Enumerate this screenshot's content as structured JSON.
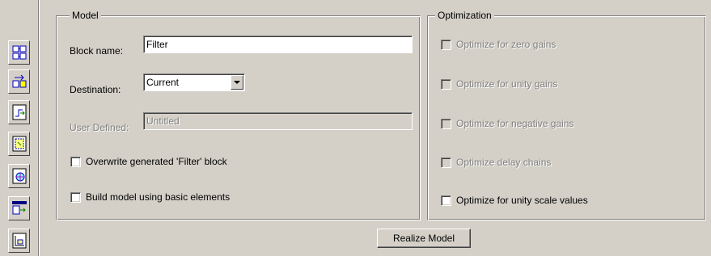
{
  "toolbar": {
    "icons": [
      "structure-icon",
      "convert-icon",
      "filter-response-icon",
      "selection-icon",
      "target-icon",
      "realize-icon",
      "transform-icon"
    ]
  },
  "model": {
    "title": "Model",
    "block_name_label": "Block name:",
    "block_name_value": "Filter",
    "destination_label": "Destination:",
    "destination_value": "Current",
    "user_defined_label": "User Defined:",
    "user_defined_value": "Untitled",
    "overwrite_label": "Overwrite generated 'Filter' block",
    "build_label": "Build model using basic elements"
  },
  "optimization": {
    "title": "Optimization",
    "zero_gains": "Optimize for zero gains",
    "unity_gains": "Optimize for unity gains",
    "negative_gains": "Optimize for negative gains",
    "delay_chains": "Optimize delay chains",
    "unity_scale": "Optimize for unity scale values"
  },
  "actions": {
    "realize_label": "Realize Model"
  }
}
